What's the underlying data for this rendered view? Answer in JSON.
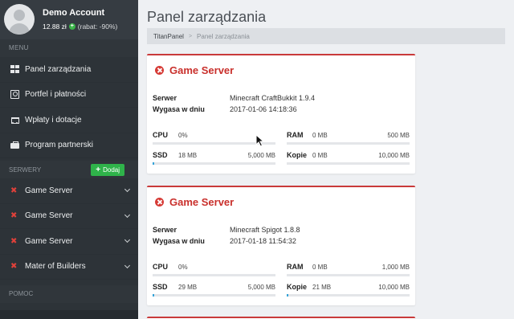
{
  "account": {
    "name": "Demo Account",
    "balance": "12.88 zł",
    "discount": "(rabat: -90%)"
  },
  "menu": {
    "label": "MENU",
    "items": [
      {
        "label": "Panel zarządzania",
        "icon": "dashboard-icon"
      },
      {
        "label": "Portfel i płatności",
        "icon": "money-icon"
      },
      {
        "label": "Wpłaty i dotacje",
        "icon": "cart-icon"
      },
      {
        "label": "Program partnerski",
        "icon": "briefcase-icon"
      }
    ]
  },
  "servers_section": {
    "label": "SERWERY",
    "add_label": "Dodaj",
    "items": [
      {
        "label": "Game Server"
      },
      {
        "label": "Game Server"
      },
      {
        "label": "Game Server"
      },
      {
        "label": "Mater of Builders"
      }
    ]
  },
  "help_label": "POMOC",
  "page": {
    "title": "Panel zarządzania",
    "breadcrumb": [
      "TitanPanel",
      "Panel zarządzania"
    ]
  },
  "labels": {
    "server": "Serwer",
    "expires": "Wygasa w dniu",
    "cpu": "CPU",
    "ram": "RAM",
    "ssd": "SSD",
    "backups": "Kopie"
  },
  "cards": [
    {
      "title": "Game Server",
      "server": "Minecraft CraftBukkit 1.9.4",
      "expires": "2017-01-06 14:18:36",
      "cpu": {
        "used": "0%",
        "total": "",
        "fraction": 0
      },
      "ram": {
        "used": "0 MB",
        "total": "500 MB",
        "fraction": 0
      },
      "ssd": {
        "used": "18 MB",
        "total": "5,000 MB",
        "fraction": 0.004
      },
      "backups": {
        "used": "0 MB",
        "total": "10,000 MB",
        "fraction": 0
      }
    },
    {
      "title": "Game Server",
      "server": "Minecraft Spigot 1.8.8",
      "expires": "2017-01-18 11:54:32",
      "cpu": {
        "used": "0%",
        "total": "",
        "fraction": 0
      },
      "ram": {
        "used": "0 MB",
        "total": "1,000 MB",
        "fraction": 0
      },
      "ssd": {
        "used": "29 MB",
        "total": "5,000 MB",
        "fraction": 0.006
      },
      "backups": {
        "used": "21 MB",
        "total": "10,000 MB",
        "fraction": 0.002
      }
    }
  ],
  "colors": {
    "accent_red": "#c9302c",
    "sidebar_bg": "#2d3338",
    "add_green": "#2fb34a",
    "bar_blue": "#35a3d8"
  }
}
